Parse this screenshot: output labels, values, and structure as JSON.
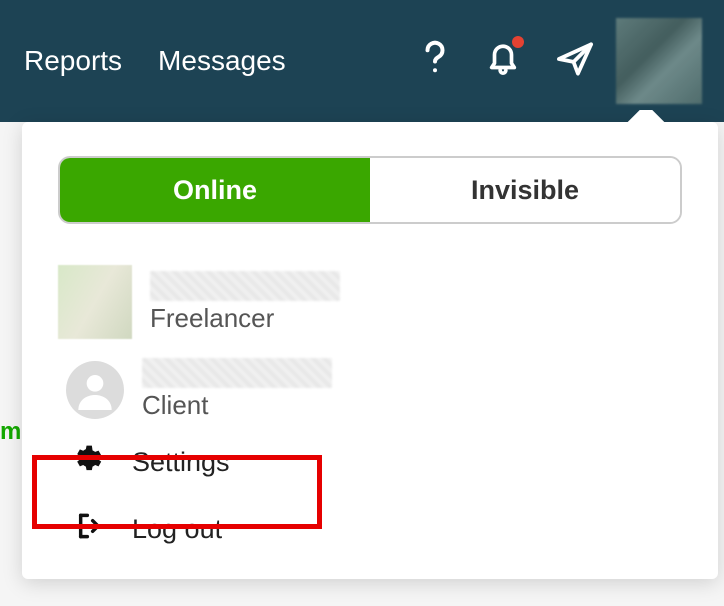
{
  "header": {
    "nav": [
      "Reports",
      "Messages"
    ]
  },
  "dropdown": {
    "status": {
      "online": "Online",
      "invisible": "Invisible"
    },
    "profiles": [
      {
        "role": "Freelancer"
      },
      {
        "role": "Client"
      }
    ],
    "menu": {
      "settings": "Settings",
      "logout": "Log out"
    }
  },
  "edge": "m."
}
